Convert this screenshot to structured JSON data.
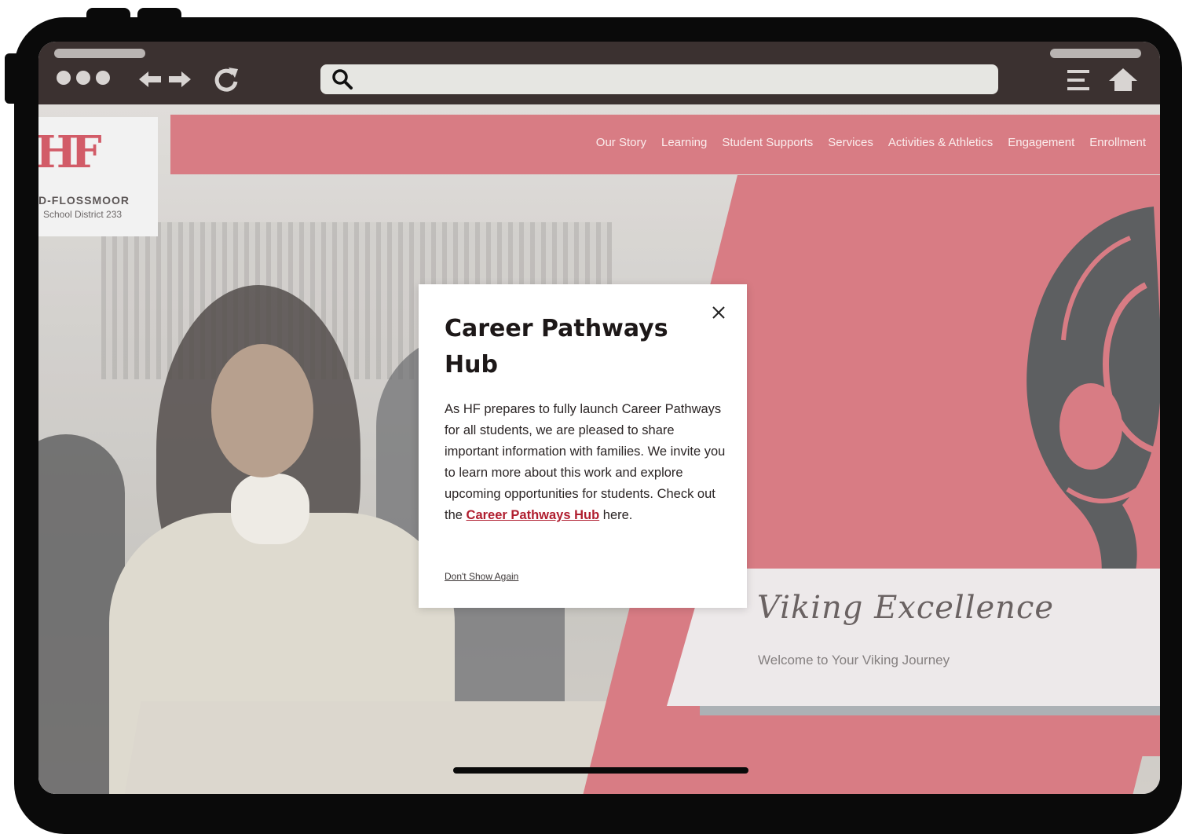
{
  "browser": {
    "url_value": ""
  },
  "nav": {
    "items": [
      "Our Story",
      "Learning",
      "Student Supports",
      "Services",
      "Activities & Athletics",
      "Engagement",
      "Enrollment"
    ]
  },
  "logo": {
    "mark": "HF",
    "name": "D-FLOSSMOOR",
    "sub": "School District 233"
  },
  "hero": {
    "title": "Viking Excellence",
    "subtitle": "Welcome to Your Viking Journey"
  },
  "modal": {
    "title": "Career Pathways Hub",
    "close_label": "×",
    "body_before": "As HF prepares to fully launch Career Pathways for all students, we are pleased to share important information with families. We invite you to learn more about this work and explore upcoming opportunities for students. Check out the ",
    "body_link": "Career Pathways Hub",
    "body_after": " here.",
    "dismiss": "Don't Show Again"
  },
  "colors": {
    "brand_red": "#d0606a",
    "link_red": "#b01e2f",
    "chrome_bg": "#3b3130"
  }
}
